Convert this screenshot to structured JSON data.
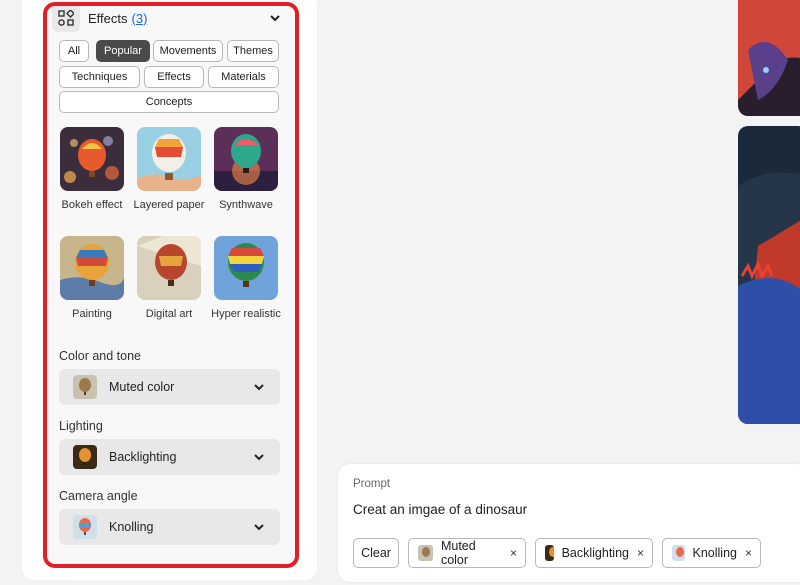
{
  "effects": {
    "title": "Effects",
    "count": "(3)"
  },
  "filters": {
    "all": "All",
    "popular": "Popular",
    "movements": "Movements",
    "themes": "Themes",
    "techniques": "Techniques",
    "effects": "Effects",
    "materials": "Materials",
    "concepts": "Concepts"
  },
  "styles": [
    {
      "label": "Bokeh effect"
    },
    {
      "label": "Layered paper"
    },
    {
      "label": "Synthwave"
    },
    {
      "label": "Painting"
    },
    {
      "label": "Digital art"
    },
    {
      "label": "Hyper realistic"
    }
  ],
  "color_tone": {
    "label": "Color and tone",
    "value": "Muted color"
  },
  "lighting": {
    "label": "Lighting",
    "value": "Backlighting"
  },
  "camera_angle": {
    "label": "Camera angle",
    "value": "Knolling"
  },
  "prompt": {
    "label": "Prompt",
    "text": "Creat an imgae of a dinosaur",
    "clear": "Clear",
    "chips": [
      "Muted color",
      "Backlighting",
      "Knolling"
    ],
    "remove_glyph": "×"
  },
  "colors": {
    "highlight": "#e01f26",
    "link": "#1a67d2",
    "active_pill": "#4a4a4a"
  }
}
